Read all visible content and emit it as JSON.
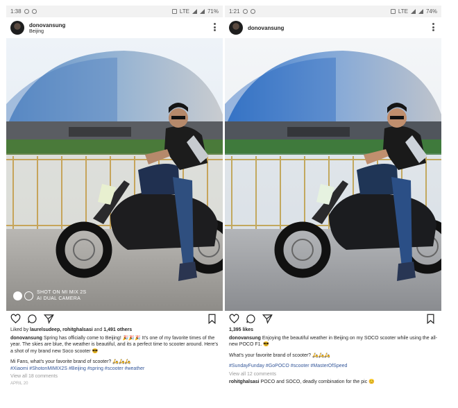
{
  "left": {
    "status": {
      "time": "1:38",
      "network": "LTE",
      "battery": "71%"
    },
    "header": {
      "username": "donovansung",
      "location": "Beijing"
    },
    "photo": {
      "watermark_line1": "SHOT ON MI MIX 2S",
      "watermark_line2": "AI DUAL CAMERA"
    },
    "likes": {
      "prefix": "Liked by ",
      "users": "laurelsudeep, rohitghalsasi",
      "and": " and ",
      "count": "1,491 others"
    },
    "caption": {
      "username": "donovansung",
      "text": " Spring has officially come to Beijing! 🎉🎉🎉 It's one of my favorite times of the year. The skies are blue, the weather is beautiful, and its a perfect time to scooter around. Here's a shot of my brand new Soco scooter 😎",
      "question": "Mi Fans, what's your favorite brand of scooter? 🛵🛵🛵",
      "hashtags": "#Xiaomi #ShotonMIMIX2S #Beijing #spring #scooter #weather"
    },
    "comments_link": "View all 18 comments",
    "date": "APRIL 20"
  },
  "right": {
    "status": {
      "time": "1:21",
      "network": "LTE",
      "battery": "74%"
    },
    "header": {
      "username": "donovansung"
    },
    "likes": {
      "count": "1,395 likes"
    },
    "caption": {
      "username": "donovansung",
      "text": " Enjoying the beautiful weather in Beijing on my SOCO scooter while using the all-new POCO F1. 😎",
      "question": "What's your favorite brand of scooter? 🛵🛵🛵",
      "hashtags": "#SundayFunday #GoPOCO #scooter #MasterOfSpeed"
    },
    "comments_link": "View all 12 comments",
    "comment": {
      "username": "rohitghalsasi",
      "text": " POCO and SOCO, deadly combination for the pic 😊"
    }
  },
  "icons": [
    "heart-icon",
    "comment-icon",
    "share-icon",
    "bookmark-icon",
    "more-options-icon",
    "whatsapp-icon",
    "reddit-icon",
    "mute-icon",
    "signal-icon",
    "battery-icon"
  ],
  "colors": {
    "hashtag": "#34579a",
    "text": "#262626",
    "muted": "#999999"
  }
}
